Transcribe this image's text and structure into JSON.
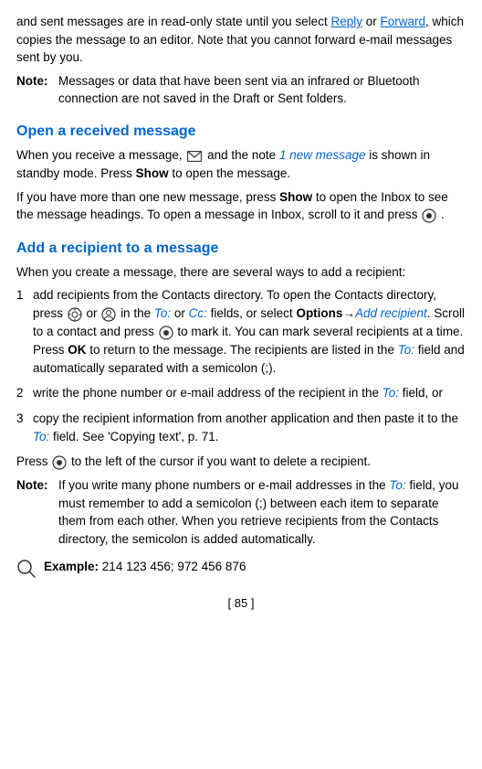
{
  "intro": {
    "para1": "and sent messages are in read-only state until you select Reply or Forward, which copies the message to an editor. Note that you cannot forward e-mail messages sent by you.",
    "reply_link": "Reply",
    "forward_link": "Forward"
  },
  "note1": {
    "label": "Note:",
    "text": "Messages or data that have been sent via an infrared or Bluetooth connection are not saved in the Draft or Sent folders."
  },
  "section1": {
    "heading": "Open a received message",
    "para1_before": "When you receive a message,",
    "para1_italic": "1 new message",
    "para1_after": "is shown in standby mode. Press",
    "para1_show": "Show",
    "para1_end": "to open the message.",
    "para2_before": "If you have more than one new message, press",
    "para2_show": "Show",
    "para2_after": "to open the Inbox to see the message headings. To open a message in Inbox, scroll to it and press"
  },
  "section2": {
    "heading": "Add a recipient to a message",
    "intro": "When you create a message, there are several ways to add a recipient:",
    "items": [
      {
        "number": "1",
        "text_before": "add recipients from the Contacts directory. To open the Contacts directory, press",
        "text_mid1": "or",
        "text_mid2": "in the",
        "to_label": "To:",
        "text_mid3": "or",
        "cc_label": "Cc:",
        "text_mid4": "fields, or select",
        "options_label": "Options",
        "arrow": "→",
        "add_recipient": "Add recipient",
        "text_mid5": ". Scroll to a contact and press",
        "text_mid6": "to mark it. You can mark several recipients at a time. Press",
        "ok_label": "OK",
        "text_mid7": "to return to the message. The recipients are listed in the",
        "to_label2": "To:",
        "text_end": "field and automatically separated with a semicolon (;)."
      },
      {
        "number": "2",
        "text_before": "write the phone number or e-mail address of the recipient in the",
        "to_label": "To:",
        "text_end": "field, or"
      },
      {
        "number": "3",
        "text_before": "copy the recipient information from another application and then paste it to the",
        "to_label": "To:",
        "text_end": "field. See 'Copying text', p. 71."
      }
    ],
    "press_line_before": "Press",
    "press_line_mid": "to the left of the cursor if you want to delete a recipient."
  },
  "note2": {
    "label": "Note:",
    "text_before": "If you write many phone numbers or e-mail addresses in the",
    "to_label": "To:",
    "text_after": "field, you must remember to add a semicolon (;) between each item to separate them from each other. When you retrieve recipients from the Contacts directory, the semicolon is added automatically."
  },
  "example": {
    "bold_label": "Example:",
    "text": "214 123 456; 972 456 876"
  },
  "footer": {
    "page_number": "[ 85 ]"
  }
}
